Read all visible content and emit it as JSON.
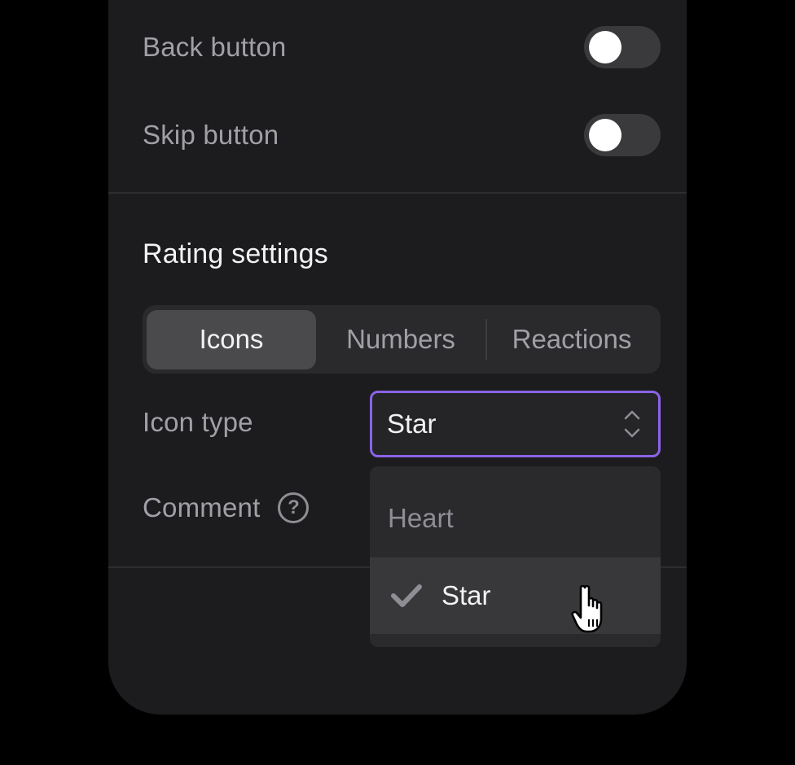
{
  "toggles": [
    {
      "label": "Back button",
      "on": false
    },
    {
      "label": "Skip button",
      "on": false
    }
  ],
  "rating_settings": {
    "title": "Rating settings",
    "tabs": [
      {
        "label": "Icons",
        "active": true
      },
      {
        "label": "Numbers",
        "active": false
      },
      {
        "label": "Reactions",
        "active": false
      }
    ],
    "icon_type_label": "Icon type",
    "icon_type_value": "Star",
    "comment_label": "Comment",
    "help_glyph": "?"
  },
  "dropdown": {
    "options": [
      {
        "label": "Heart",
        "selected": false
      },
      {
        "label": "Star",
        "selected": true
      }
    ]
  },
  "colors": {
    "background": "#000000",
    "panel": "#1c1c1e",
    "focus_border": "#8a63e8",
    "text_primary": "#f2f2f4",
    "text_secondary": "#a0a0a6"
  },
  "icons": [
    "toggle-knob",
    "chevron-up-down-icon",
    "help-icon",
    "check-icon",
    "hand-pointer-cursor-icon"
  ]
}
